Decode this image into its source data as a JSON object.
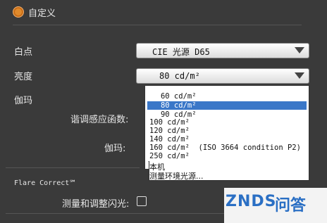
{
  "custom": {
    "label": "自定义"
  },
  "settings": {
    "white_point": {
      "label": "白点",
      "value": "CIE 光源 D65"
    },
    "brightness": {
      "label": "亮度",
      "value": "80 cd/m²"
    },
    "gamma": {
      "label": "伽玛"
    },
    "tone_response": {
      "label": "谐调感应函数:"
    },
    "gamma_value": {
      "label": "伽玛:"
    }
  },
  "dropdown": {
    "options": [
      "   60 cd/m²",
      "   80 cd/m²",
      "   90 cd/m²",
      "100 cd/m²",
      "120 cd/m²",
      "140 cd/m²",
      "160 cd/m²  (ISO 3664 condition P2)",
      "250 cd/m²",
      "本机",
      "测量环境光源..."
    ],
    "selected_index": 1
  },
  "flare": {
    "section_title": "Flare Correct℠",
    "checkbox_label": "测量和调整闪光:"
  },
  "watermark": {
    "brand": "ZNDS",
    "chinese": "问答"
  },
  "colors": {
    "accent": "#e08a2c",
    "selection": "#3a77c8",
    "watermark": "#2a6fc4"
  }
}
